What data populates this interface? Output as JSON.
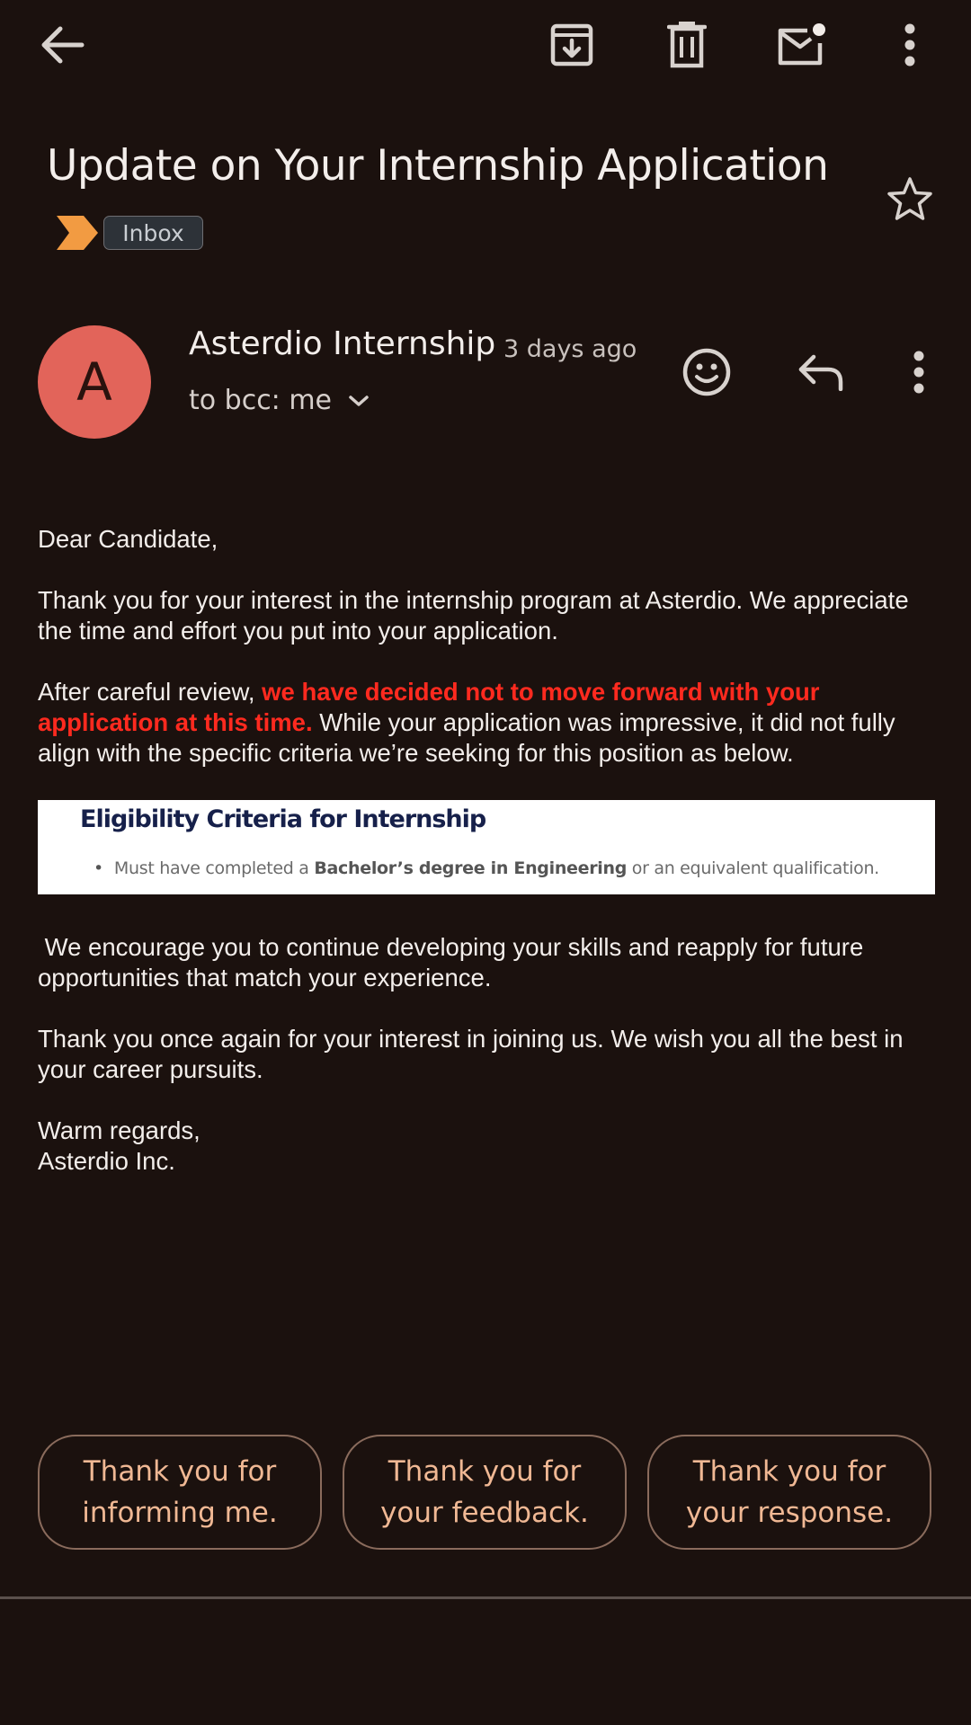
{
  "toolbar": {
    "back_icon": "arrow-left-icon",
    "archive_icon": "archive-icon",
    "delete_icon": "trash-icon",
    "mark_unread_icon": "mail-unread-icon",
    "more_icon": "more-vert-icon"
  },
  "email": {
    "subject": "Update on Your Internship Application",
    "label": "Inbox",
    "important_color": "#f29b42",
    "sender": {
      "initial": "A",
      "name": "Asterdio Internship",
      "time": "3 days ago",
      "recipient": "to bcc: me",
      "avatar_color": "#e2645a"
    },
    "body": {
      "greeting": "Dear Candidate,",
      "p1": "Thank you for your interest in the internship program at Asterdio. We appreciate the time and effort you put into your application.",
      "p2_start": "After careful review, ",
      "p2_highlight": "we have decided not to move forward with your application at this time.",
      "p2_end": " While your application was impressive, it did not fully align with the specific criteria we’re seeking for this position as below.",
      "criteria_title": "Eligibility Criteria for Internship",
      "criteria_item_start": "Must have completed a ",
      "criteria_item_bold": "Bachelor’s degree in Engineering",
      "criteria_item_end": " or an equivalent qualification.",
      "p3": " We encourage you to continue developing your skills and reapply for future opportunities that match your experience.",
      "p4": "Thank you once again for your interest in joining us. We wish you all the best in your career pursuits.",
      "signoff": "Warm regards,",
      "company": "Asterdio Inc."
    }
  },
  "smart_replies": [
    "Thank you for\ninforming me.",
    "Thank you for\nyour feedback.",
    "Thank you for\nyour response."
  ]
}
